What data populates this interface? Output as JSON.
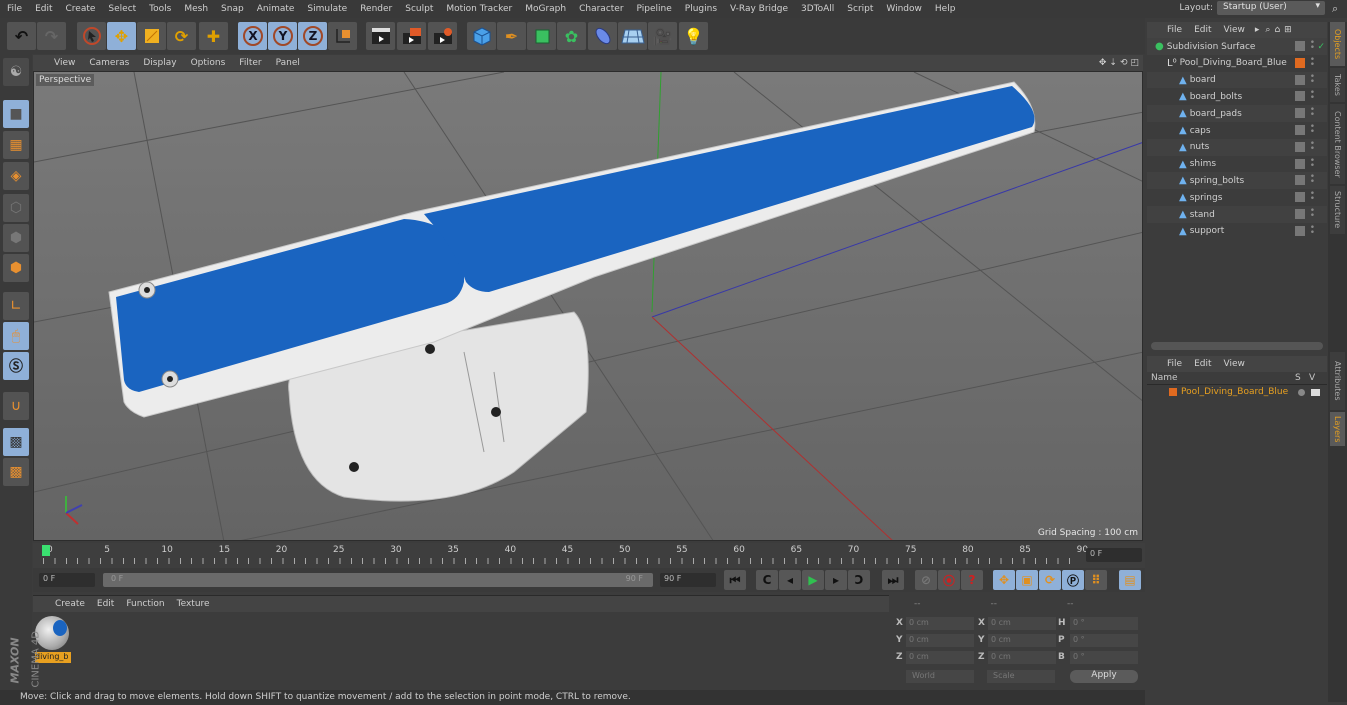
{
  "menu": [
    "File",
    "Edit",
    "Create",
    "Select",
    "Tools",
    "Mesh",
    "Snap",
    "Animate",
    "Simulate",
    "Render",
    "Sculpt",
    "Motion Tracker",
    "MoGraph",
    "Character",
    "Pipeline",
    "Plugins",
    "V-Ray Bridge",
    "3DToAll",
    "Script",
    "Window",
    "Help"
  ],
  "layout": {
    "label": "Layout:",
    "value": "Startup (User)"
  },
  "toolbar": {
    "icons": [
      "undo-icon",
      "redo-icon",
      "live-selection-icon",
      "move-icon",
      "scale-icon",
      "rotate-icon",
      "recent-tool-icon",
      "x-axis-icon",
      "y-axis-icon",
      "z-axis-icon",
      "coordinate-system-icon",
      "render-view-icon",
      "render-picture-viewer-icon",
      "render-settings-icon",
      "cube-icon",
      "pen-spline-icon",
      "subdivision-surface-icon",
      "cloner-icon",
      "deformer-icon",
      "floor-icon",
      "camera-icon",
      "light-icon"
    ],
    "axis_labels": [
      "X",
      "Y",
      "Z"
    ]
  },
  "left_tools": [
    "model-mode-icon",
    "texture-mode-icon",
    "workplane-mode-icon",
    "points-mode-icon",
    "edges-mode-icon",
    "polygons-mode-icon",
    "axis-mode-icon",
    "tweak-mode-icon",
    "solo-mode-icon",
    "snap-icon",
    "workplane-lock-icon",
    "planar-workplane-icon"
  ],
  "viewport": {
    "menu": [
      "View",
      "Cameras",
      "Display",
      "Options",
      "Filter",
      "Panel"
    ],
    "camera_label": "Perspective",
    "grid_spacing": "Grid Spacing : 100 cm",
    "colors": {
      "board_blue": "#1a64c0",
      "board_white": "#e8e8e8",
      "x_axis": "#b03030",
      "y_axis": "#30a030",
      "z_axis": "#3030a0"
    }
  },
  "timeline": {
    "ticks": [
      "0",
      "5",
      "10",
      "15",
      "20",
      "25",
      "30",
      "35",
      "40",
      "45",
      "50",
      "55",
      "60",
      "65",
      "70",
      "75",
      "80",
      "85",
      "90"
    ],
    "current_frame": "0 F",
    "start_field": "0 F",
    "range_start": "0 F",
    "range_end": "90 F",
    "end_field": "90 F"
  },
  "transport": [
    "go-to-start-icon",
    "previous-key-icon",
    "previous-frame-icon",
    "play-icon",
    "next-frame-icon",
    "next-key-icon",
    "go-to-end-icon",
    "motion-record-icon",
    "record-active-icon",
    "autokey-icon",
    "key-position-icon",
    "key-scale-icon",
    "key-rotation-icon",
    "key-param-icon",
    "key-pla-icon",
    "timeline-icon"
  ],
  "materials": {
    "menu": [
      "Create",
      "Edit",
      "Function",
      "Texture"
    ],
    "items": [
      {
        "name": "diving_b"
      }
    ]
  },
  "brand": {
    "maxon": "MAXON",
    "cinema": "CINEMA 4D"
  },
  "coordinates": {
    "headers": [
      "--",
      "--",
      "--"
    ],
    "rows": [
      {
        "l1": "X",
        "v1": "0 cm",
        "l2": "X",
        "v2": "0 cm",
        "l3": "H",
        "v3": "0 °"
      },
      {
        "l1": "Y",
        "v1": "0 cm",
        "l2": "Y",
        "v2": "0 cm",
        "l3": "P",
        "v3": "0 °"
      },
      {
        "l1": "Z",
        "v1": "0 cm",
        "l2": "Z",
        "v2": "0 cm",
        "l3": "B",
        "v3": "0 °"
      }
    ],
    "mode": "World",
    "type": "Scale",
    "apply": "Apply"
  },
  "status": "Move: Click and drag to move elements. Hold down SHIFT to quantize movement / add to the selection in point mode, CTRL to remove.",
  "objects": {
    "menu": [
      "File",
      "Edit",
      "View"
    ],
    "items": [
      {
        "name": "Subdivision Surface",
        "level": 0
      },
      {
        "name": "Pool_Diving_Board_Blue",
        "level": 1
      },
      {
        "name": "board",
        "level": 2
      },
      {
        "name": "board_bolts",
        "level": 2
      },
      {
        "name": "board_pads",
        "level": 2
      },
      {
        "name": "caps",
        "level": 2
      },
      {
        "name": "nuts",
        "level": 2
      },
      {
        "name": "shims",
        "level": 2
      },
      {
        "name": "spring_bolts",
        "level": 2
      },
      {
        "name": "springs",
        "level": 2
      },
      {
        "name": "stand",
        "level": 2
      },
      {
        "name": "support",
        "level": 2
      }
    ]
  },
  "layers": {
    "menu": [
      "File",
      "Edit",
      "View"
    ],
    "columns": [
      "Name",
      "S",
      "V"
    ],
    "items": [
      {
        "name": "Pool_Diving_Board_Blue",
        "color": "#e06a20"
      }
    ]
  },
  "side_tabs": {
    "top": [
      "Objects",
      "Takes",
      "Content Browser",
      "Structure"
    ],
    "bottom": [
      "Attributes",
      "Layers"
    ]
  }
}
